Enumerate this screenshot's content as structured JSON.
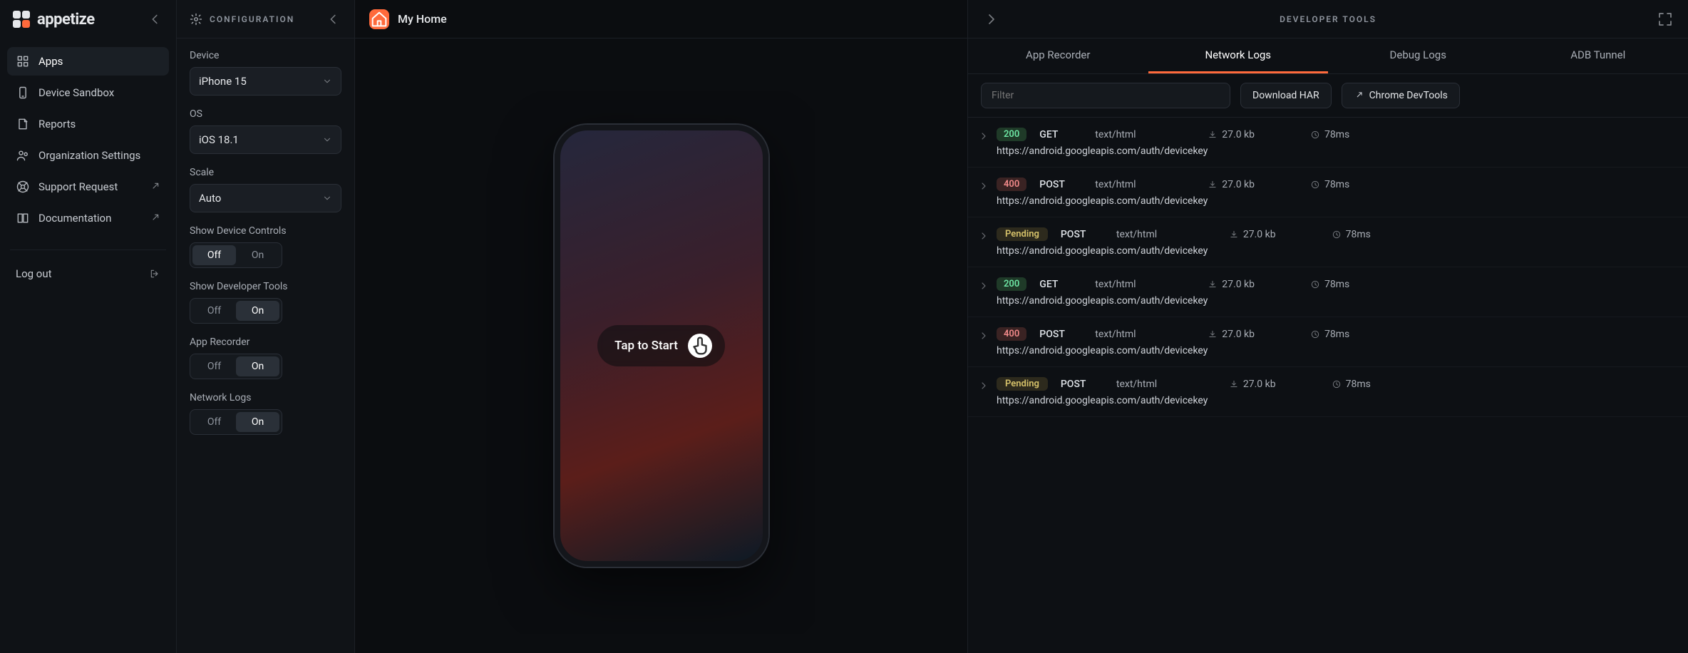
{
  "brand": {
    "name": "appetize"
  },
  "sidebar": {
    "items": [
      {
        "label": "Apps",
        "icon": "apps-icon",
        "active": true
      },
      {
        "label": "Device Sandbox",
        "icon": "device-icon"
      },
      {
        "label": "Reports",
        "icon": "reports-icon"
      },
      {
        "label": "Organization Settings",
        "icon": "org-icon"
      },
      {
        "label": "Support Request",
        "icon": "support-icon",
        "external": true
      },
      {
        "label": "Documentation",
        "icon": "docs-icon",
        "external": true
      }
    ],
    "logout": "Log out"
  },
  "config": {
    "title": "CONFIGURATION",
    "device_label": "Device",
    "device_value": "iPhone 15",
    "os_label": "OS",
    "os_value": "iOS 18.1",
    "scale_label": "Scale",
    "scale_value": "Auto",
    "toggles": [
      {
        "label": "Show Device Controls",
        "off": "Off",
        "on": "On",
        "value": "Off"
      },
      {
        "label": "Show Developer Tools",
        "off": "Off",
        "on": "On",
        "value": "On"
      },
      {
        "label": "App Recorder",
        "off": "Off",
        "on": "On",
        "value": "On"
      },
      {
        "label": "Network Logs",
        "off": "Off",
        "on": "On",
        "value": "On"
      }
    ]
  },
  "stage": {
    "header_title": "My Home",
    "tap_label": "Tap to Start"
  },
  "devtools": {
    "title": "DEVELOPER TOOLS",
    "tabs": [
      "App Recorder",
      "Network Logs",
      "Debug Logs",
      "ADB Tunnel"
    ],
    "active_tab": 1,
    "filter_placeholder": "Filter",
    "download_har": "Download HAR",
    "chrome_devtools": "Chrome DevTools",
    "logs": [
      {
        "status": "200",
        "status_class": "s200",
        "method": "GET",
        "ctype": "text/html",
        "size": "27.0 kb",
        "time": "78ms",
        "url": "https://android.googleapis.com/auth/devicekey"
      },
      {
        "status": "400",
        "status_class": "s400",
        "method": "POST",
        "ctype": "text/html",
        "size": "27.0 kb",
        "time": "78ms",
        "url": "https://android.googleapis.com/auth/devicekey"
      },
      {
        "status": "Pending",
        "status_class": "spending",
        "method": "POST",
        "ctype": "text/html",
        "size": "27.0 kb",
        "time": "78ms",
        "url": "https://android.googleapis.com/auth/devicekey"
      },
      {
        "status": "200",
        "status_class": "s200",
        "method": "GET",
        "ctype": "text/html",
        "size": "27.0 kb",
        "time": "78ms",
        "url": "https://android.googleapis.com/auth/devicekey"
      },
      {
        "status": "400",
        "status_class": "s400",
        "method": "POST",
        "ctype": "text/html",
        "size": "27.0 kb",
        "time": "78ms",
        "url": "https://android.googleapis.com/auth/devicekey"
      },
      {
        "status": "Pending",
        "status_class": "spending",
        "method": "POST",
        "ctype": "text/html",
        "size": "27.0 kb",
        "time": "78ms",
        "url": "https://android.googleapis.com/auth/devicekey"
      }
    ]
  }
}
